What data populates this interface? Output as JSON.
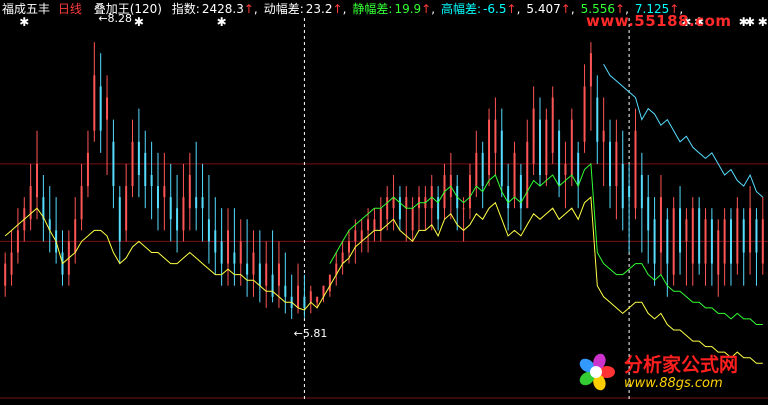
{
  "header": {
    "ticker": "福成五丰",
    "period": "日线",
    "indicator": "叠加王(120)",
    "metrics": [
      {
        "label": "指数:",
        "value": "2428.3",
        "arrow": "↑",
        "color": "#ffffff"
      },
      {
        "label": "动幅差:",
        "value": "23.2",
        "arrow": "↑",
        "color": "#ffffff"
      },
      {
        "label": "静幅差:",
        "value": "19.9",
        "arrow": "↑",
        "color": "#33ff33"
      },
      {
        "label": "高幅差:",
        "value": "-6.5",
        "arrow": "↑",
        "color": "#00ffff"
      }
    ],
    "extra_values": [
      {
        "value": "5.407",
        "color": "#ffffff"
      },
      {
        "value": "5.556",
        "color": "#33ff33"
      },
      {
        "value": "7.125",
        "color": "#00ffff"
      }
    ]
  },
  "annotations": {
    "low_label": "←5.81",
    "high_label": "←8.28"
  },
  "watermarks": {
    "top": "www.55188.com",
    "bottom_cn": "分析家公式网",
    "bottom_url": "www.88gs.com"
  },
  "colors": {
    "bull": "#ff5555",
    "bear": "#55ddff",
    "yellow_line": "#ffff44",
    "green_line": "#33ff33",
    "cyan_line": "#55ddff",
    "grid": "#7a1010",
    "marker": "#ffffff"
  },
  "chart_data": {
    "type": "line",
    "title": "",
    "xlabel": "",
    "ylabel": "",
    "ylim": [
      5.7,
      8.5
    ],
    "candles": {
      "high": [
        6.4,
        6.6,
        6.8,
        6.9,
        7.2,
        7.5,
        7.1,
        7.0,
        6.9,
        6.6,
        6.6,
        6.9,
        7.2,
        7.5,
        8.3,
        8.2,
        8.0,
        7.6,
        7.0,
        7.2,
        7.6,
        7.7,
        7.5,
        7.4,
        7.3,
        7.3,
        7.2,
        7.1,
        7.2,
        7.3,
        7.4,
        7.2,
        7.1,
        6.9,
        6.8,
        6.8,
        6.8,
        6.7,
        6.7,
        6.6,
        6.6,
        6.5,
        6.6,
        6.5,
        6.4,
        6.2,
        6.3,
        6.2,
        6.1,
        6.0,
        6.1,
        6.2,
        6.4,
        6.5,
        6.6,
        6.7,
        6.7,
        6.8,
        6.8,
        6.9,
        7.0,
        7.1,
        7.0,
        7.0,
        6.9,
        7.0,
        7.0,
        7.1,
        7.0,
        7.2,
        7.3,
        7.1,
        6.9,
        7.2,
        7.5,
        7.4,
        7.7,
        7.8,
        7.7,
        7.2,
        7.4,
        7.2,
        7.6,
        7.9,
        7.8,
        7.7,
        7.9,
        7.6,
        7.4,
        7.7,
        7.4,
        8.1,
        8.3,
        8.0,
        7.8,
        7.6,
        7.6,
        7.5,
        7.2,
        7.7,
        7.3,
        7.1,
        6.9,
        7.1,
        6.8,
        6.9,
        7.0,
        6.8,
        6.9,
        6.9,
        6.8,
        6.8,
        6.7,
        6.8,
        6.8,
        6.9,
        6.8,
        7.0,
        6.8,
        6.9
      ],
      "low": [
        6.0,
        6.1,
        6.3,
        6.5,
        6.6,
        6.7,
        6.5,
        6.4,
        6.3,
        6.1,
        6.1,
        6.3,
        6.6,
        6.9,
        7.4,
        7.3,
        7.1,
        6.8,
        6.3,
        6.5,
        6.9,
        6.9,
        6.8,
        6.7,
        6.6,
        6.6,
        6.5,
        6.4,
        6.5,
        6.6,
        6.6,
        6.5,
        6.3,
        6.2,
        6.1,
        6.1,
        6.1,
        6.1,
        6.0,
        6.0,
        5.95,
        5.9,
        5.95,
        5.9,
        5.85,
        5.8,
        5.85,
        5.81,
        5.85,
        5.9,
        5.95,
        6.0,
        6.1,
        6.2,
        6.3,
        6.3,
        6.4,
        6.4,
        6.5,
        6.5,
        6.6,
        6.6,
        6.6,
        6.5,
        6.5,
        6.6,
        6.6,
        6.6,
        6.6,
        6.7,
        6.7,
        6.6,
        6.5,
        6.7,
        6.9,
        6.8,
        7.0,
        7.1,
        6.9,
        6.6,
        6.8,
        6.6,
        6.9,
        7.1,
        7.0,
        7.0,
        7.2,
        6.9,
        6.8,
        7.0,
        6.8,
        7.3,
        7.5,
        7.2,
        7.0,
        6.8,
        6.7,
        6.6,
        6.4,
        6.7,
        6.4,
        6.3,
        6.1,
        6.2,
        6.0,
        6.1,
        6.2,
        6.1,
        6.1,
        6.2,
        6.1,
        6.1,
        6.0,
        6.1,
        6.1,
        6.2,
        6.1,
        6.2,
        6.1,
        6.2
      ],
      "open": [
        6.1,
        6.2,
        6.4,
        6.6,
        6.7,
        6.9,
        6.9,
        6.7,
        6.6,
        6.4,
        6.2,
        6.4,
        6.7,
        7.0,
        7.5,
        7.9,
        7.6,
        7.4,
        6.9,
        6.6,
        7.0,
        7.4,
        7.3,
        7.1,
        7.0,
        6.9,
        6.9,
        6.8,
        6.6,
        6.8,
        6.9,
        6.9,
        6.7,
        6.6,
        6.5,
        6.3,
        6.4,
        6.3,
        6.3,
        6.2,
        6.3,
        6.1,
        6.2,
        6.1,
        6.1,
        6.0,
        5.9,
        6.0,
        5.95,
        5.95,
        6.0,
        6.05,
        6.2,
        6.3,
        6.4,
        6.5,
        6.5,
        6.6,
        6.6,
        6.6,
        6.7,
        6.8,
        6.9,
        6.8,
        6.6,
        6.8,
        6.8,
        6.8,
        6.9,
        6.8,
        6.9,
        7.0,
        6.8,
        6.8,
        7.0,
        7.3,
        7.1,
        7.3,
        7.5,
        7.0,
        6.9,
        7.1,
        6.8,
        7.2,
        7.6,
        7.1,
        7.3,
        7.5,
        7.1,
        7.1,
        7.3,
        7.4,
        7.9,
        7.8,
        7.4,
        7.4,
        7.0,
        7.2,
        7.0,
        6.8,
        7.1,
        6.9,
        6.7,
        6.4,
        6.7,
        6.2,
        6.8,
        6.5,
        6.3,
        6.8,
        6.3,
        6.7,
        6.2,
        6.3,
        6.7,
        6.3,
        6.7,
        6.4,
        6.7,
        6.3
      ],
      "close": [
        6.3,
        6.4,
        6.6,
        6.8,
        7.0,
        7.2,
        6.7,
        6.6,
        6.4,
        6.2,
        6.5,
        6.7,
        7.0,
        7.3,
        8.0,
        7.5,
        7.8,
        7.0,
        6.5,
        7.0,
        7.4,
        7.1,
        7.0,
        7.0,
        6.8,
        7.0,
        6.7,
        6.6,
        6.9,
        7.1,
        6.8,
        6.8,
        6.5,
        6.4,
        6.3,
        6.6,
        6.3,
        6.5,
        6.2,
        6.4,
        6.1,
        6.3,
        6.0,
        6.3,
        6.0,
        5.9,
        6.1,
        5.9,
        6.05,
        6.0,
        6.1,
        6.2,
        6.3,
        6.4,
        6.5,
        6.6,
        6.6,
        6.7,
        6.7,
        6.8,
        6.9,
        6.9,
        6.7,
        6.9,
        6.8,
        6.9,
        6.9,
        7.0,
        6.7,
        7.1,
        7.1,
        6.8,
        6.8,
        7.1,
        7.3,
        7.0,
        7.6,
        7.6,
        7.0,
        6.8,
        7.3,
        6.8,
        7.4,
        7.7,
        7.1,
        7.6,
        7.8,
        7.0,
        7.2,
        7.6,
        7.0,
        7.9,
        8.2,
        7.4,
        7.5,
        7.0,
        7.4,
        6.8,
        6.9,
        7.5,
        6.8,
        6.6,
        6.3,
        6.9,
        6.3,
        6.8,
        6.4,
        6.7,
        6.8,
        6.3,
        6.7,
        6.3,
        6.6,
        6.7,
        6.3,
        6.8,
        6.4,
        6.8,
        6.4,
        6.7
      ]
    },
    "series": [
      {
        "values": [
          6.55,
          6.6,
          6.65,
          6.7,
          6.75,
          6.8,
          6.72,
          6.6,
          6.5,
          6.3,
          6.35,
          6.4,
          6.5,
          6.55,
          6.6,
          6.6,
          6.55,
          6.4,
          6.3,
          6.35,
          6.45,
          6.5,
          6.45,
          6.4,
          6.4,
          6.35,
          6.3,
          6.3,
          6.35,
          6.4,
          6.35,
          6.3,
          6.25,
          6.2,
          6.2,
          6.25,
          6.2,
          6.2,
          6.15,
          6.15,
          6.1,
          6.05,
          6.05,
          6.0,
          5.95,
          5.95,
          5.9,
          5.88,
          5.95,
          5.9,
          6.0,
          6.1,
          6.2,
          6.3,
          6.35,
          6.45,
          6.5,
          6.55,
          6.6,
          6.6,
          6.65,
          6.7,
          6.6,
          6.55,
          6.5,
          6.6,
          6.6,
          6.65,
          6.55,
          6.7,
          6.75,
          6.65,
          6.6,
          6.65,
          6.75,
          6.7,
          6.8,
          6.85,
          6.7,
          6.55,
          6.6,
          6.55,
          6.65,
          6.75,
          6.7,
          6.75,
          6.8,
          6.7,
          6.75,
          6.8,
          6.7,
          6.85,
          6.9,
          6.1,
          6.0,
          5.95,
          5.9,
          5.85,
          5.9,
          5.95,
          5.95,
          5.85,
          5.8,
          5.85,
          5.75,
          5.7,
          5.7,
          5.65,
          5.6,
          5.6,
          5.55,
          5.55,
          5.5,
          5.5,
          5.45,
          5.5,
          5.45,
          5.45,
          5.4,
          5.4
        ]
      },
      {
        "values": [
          null,
          null,
          null,
          null,
          null,
          null,
          null,
          null,
          null,
          null,
          null,
          null,
          null,
          null,
          null,
          null,
          null,
          null,
          null,
          null,
          null,
          null,
          null,
          null,
          null,
          null,
          null,
          null,
          null,
          null,
          null,
          null,
          null,
          null,
          null,
          null,
          null,
          null,
          null,
          null,
          null,
          null,
          null,
          null,
          null,
          null,
          null,
          null,
          null,
          null,
          null,
          6.3,
          6.4,
          6.5,
          6.6,
          6.65,
          6.7,
          6.75,
          6.8,
          6.8,
          6.85,
          6.9,
          6.85,
          6.8,
          6.8,
          6.85,
          6.85,
          6.9,
          6.85,
          6.95,
          7.0,
          6.9,
          6.85,
          6.9,
          7.0,
          6.95,
          7.05,
          7.1,
          6.95,
          6.85,
          6.9,
          6.85,
          6.95,
          7.05,
          7.0,
          7.05,
          7.1,
          7.0,
          7.05,
          7.1,
          7.0,
          7.15,
          7.2,
          6.4,
          6.3,
          6.25,
          6.2,
          6.2,
          6.25,
          6.3,
          6.3,
          6.2,
          6.15,
          6.2,
          6.1,
          6.05,
          6.05,
          6.0,
          5.95,
          5.95,
          5.9,
          5.9,
          5.85,
          5.85,
          5.8,
          5.85,
          5.8,
          5.8,
          5.75,
          5.75
        ]
      },
      {
        "values": [
          null,
          null,
          null,
          null,
          null,
          null,
          null,
          null,
          null,
          null,
          null,
          null,
          null,
          null,
          null,
          null,
          null,
          null,
          null,
          null,
          null,
          null,
          null,
          null,
          null,
          null,
          null,
          null,
          null,
          null,
          null,
          null,
          null,
          null,
          null,
          null,
          null,
          null,
          null,
          null,
          null,
          null,
          null,
          null,
          null,
          null,
          null,
          null,
          null,
          null,
          null,
          null,
          null,
          null,
          null,
          null,
          null,
          null,
          null,
          null,
          null,
          null,
          null,
          null,
          null,
          null,
          null,
          null,
          null,
          null,
          null,
          null,
          null,
          null,
          null,
          null,
          null,
          null,
          null,
          null,
          null,
          null,
          null,
          null,
          null,
          null,
          null,
          null,
          null,
          null,
          null,
          null,
          null,
          null,
          8.1,
          8.0,
          7.95,
          7.9,
          7.85,
          7.8,
          7.6,
          7.7,
          7.65,
          7.55,
          7.6,
          7.5,
          7.4,
          7.45,
          7.35,
          7.3,
          7.25,
          7.3,
          7.2,
          7.1,
          7.15,
          7.05,
          7.0,
          7.1,
          6.95,
          6.9
        ]
      }
    ],
    "markers_x_index": [
      3,
      21,
      34,
      107,
      109,
      116,
      117,
      119
    ]
  }
}
